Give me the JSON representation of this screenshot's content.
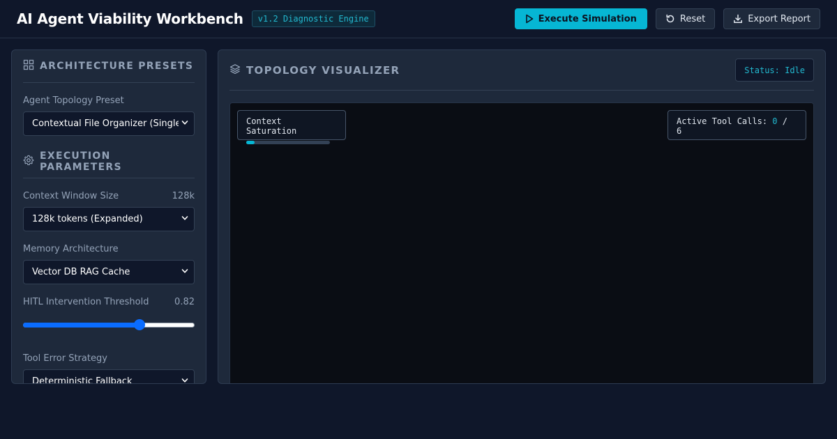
{
  "header": {
    "title": "AI Agent Viability Workbench",
    "version_badge": "v1.2 Diagnostic Engine",
    "execute_label": "Execute Simulation",
    "reset_label": "Reset",
    "export_label": "Export Report"
  },
  "presets": {
    "section_title": "ARCHITECTURE PRESETS",
    "topology_label": "Agent Topology Preset",
    "topology_value": "Contextual File Organizer (Single-Pass)"
  },
  "execution": {
    "section_title": "EXECUTION PARAMETERS",
    "context_label": "Context Window Size",
    "context_value": "128k",
    "context_select": "128k tokens (Expanded)",
    "memory_label": "Memory Architecture",
    "memory_select": "Vector DB RAG Cache",
    "hitl_label": "HITL Intervention Threshold",
    "hitl_value": "0.82",
    "hitl_fraction": 0.68,
    "tool_error_label": "Tool Error Strategy",
    "tool_error_select": "Deterministic Fallback"
  },
  "visualizer": {
    "title": "TOPOLOGY VISUALIZER",
    "status": "Status: Idle",
    "context_saturation_label": "Context Saturation",
    "context_saturation_fraction": 0.1,
    "tool_calls_label": "Active Tool Calls:",
    "tool_calls_active": "0",
    "tool_calls_sep": "/",
    "tool_calls_total": "6"
  },
  "colors": {
    "accent": "#06b6d4",
    "background": "#0f172a",
    "panel": "#1e293b",
    "slider": "#0a6cff"
  }
}
